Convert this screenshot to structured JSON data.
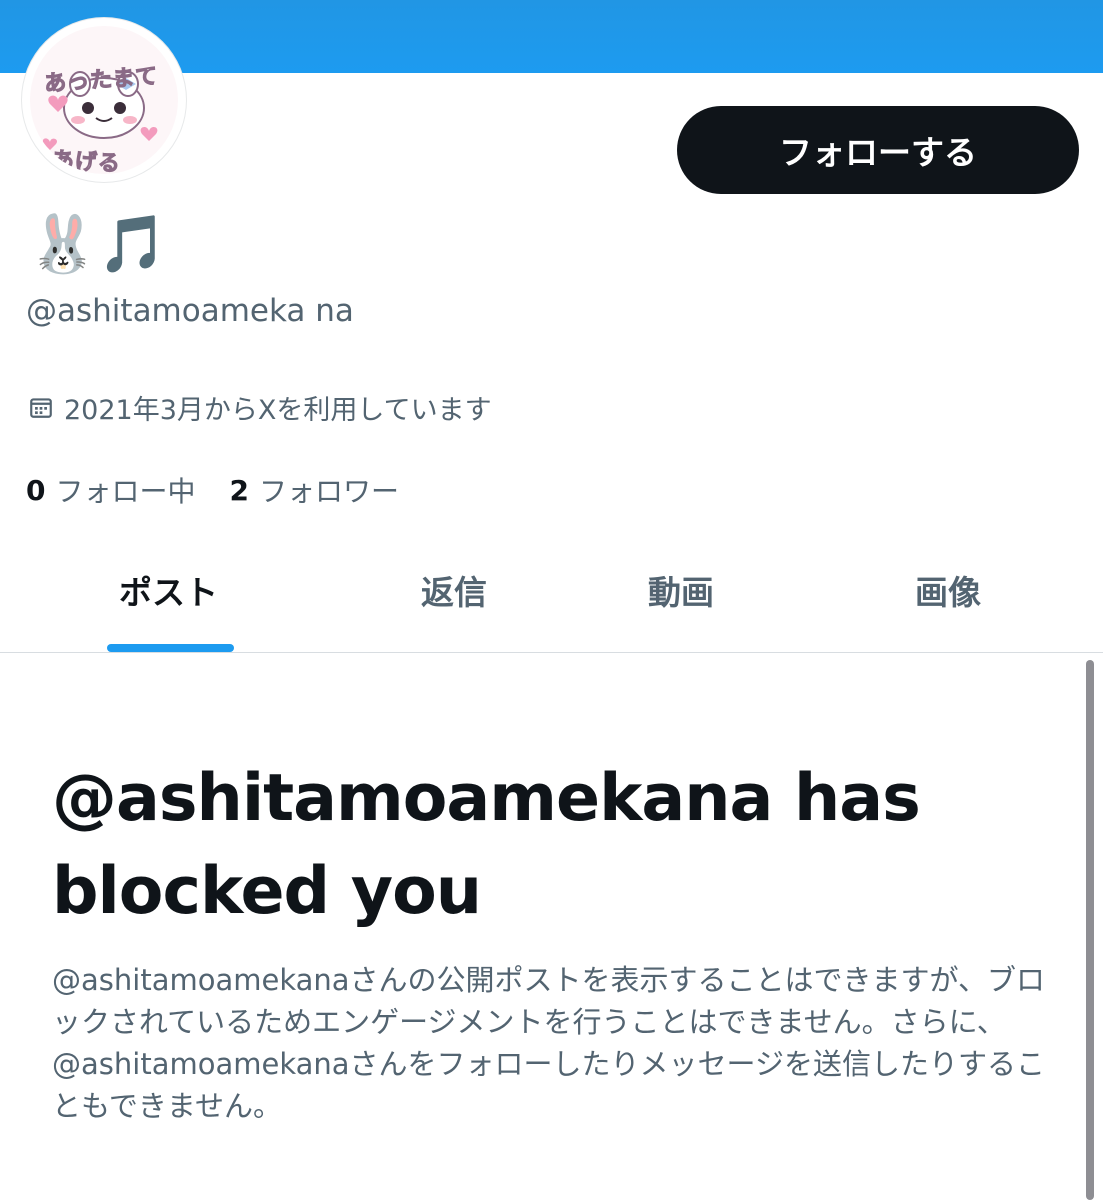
{
  "header": {
    "banner_color": "#1d9bf0"
  },
  "profile": {
    "avatar_alt": "profile avatar",
    "avatar_text_top": "あったまて",
    "avatar_text_bottom": "あげる",
    "display_name": "🐰🎵",
    "handle": "@ashitamoameka na",
    "joined": "2021年3月からXを利用しています",
    "following_count": "0",
    "following_label": "フォロー中",
    "followers_count": "2",
    "followers_label": "フォロワー",
    "follow_button_label": "フォローする"
  },
  "tabs": [
    {
      "label": "ポスト",
      "active": true
    },
    {
      "label": "返信",
      "active": false
    },
    {
      "label": "動画",
      "active": false
    },
    {
      "label": "画像",
      "active": false
    }
  ],
  "blocked": {
    "title": "@ashitamoamekana has blocked you",
    "body": "@ashitamoamekanaさんの公開ポストを表示することはできますが、ブロックされているためエンゲージメントを行うことはできません。さらに、@ashitamoamekanaさんをフォローしたりメッセージを送信したりすることもできません。"
  },
  "colors": {
    "accent": "#1d9bf0",
    "text_primary": "#0f1419",
    "text_secondary": "#536471",
    "button_bg": "#0f1419"
  },
  "icons": {
    "calendar": "calendar-icon"
  }
}
